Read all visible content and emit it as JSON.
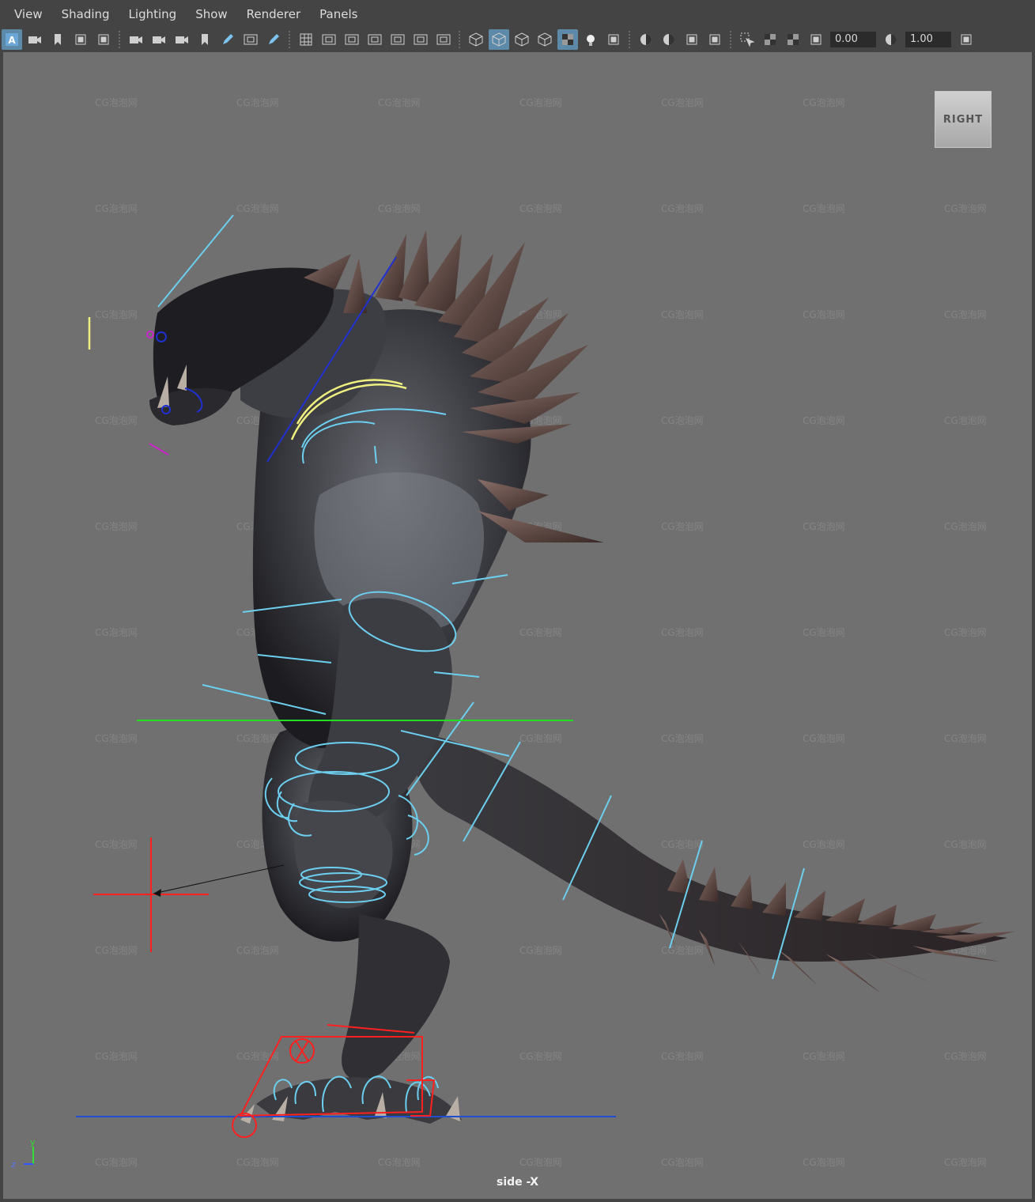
{
  "menu": {
    "items": [
      {
        "id": "view",
        "label": "View"
      },
      {
        "id": "shading",
        "label": "Shading"
      },
      {
        "id": "lighting",
        "label": "Lighting"
      },
      {
        "id": "show",
        "label": "Show"
      },
      {
        "id": "renderer",
        "label": "Renderer"
      },
      {
        "id": "panels",
        "label": "Panels"
      }
    ]
  },
  "toolbar": {
    "exposure_value": "0.00",
    "gamma_value": "1.00",
    "icons": [
      "select-camera-icon",
      "camera-attributes-icon",
      "bookmarks-icon",
      "image-plane-icon",
      "2d-pan-zoom-icon",
      "camera-icon",
      "lock-camera-icon",
      "camera-film-icon",
      "bookmark-icon",
      "grease-pencil-icon",
      "gate-icon",
      "paint-icon",
      "grid-icon",
      "film-gate-icon",
      "resolution-gate-icon",
      "gate-mask-icon",
      "field-chart-icon",
      "safe-action-icon",
      "safe-title-icon",
      "wireframe-icon",
      "smooth-shade-icon",
      "default-material-icon",
      "wireframe-on-shaded-icon",
      "xray-icon",
      "use-lights-icon",
      "shadows-icon",
      "screen-space-ao-icon",
      "motion-blur-icon",
      "anti-aliasing-icon",
      "depth-of-field-icon",
      "isolate-select-icon",
      "xray-joints-icon",
      "xray-active-icon",
      "backface-culling-icon",
      "exposure-icon",
      "gamma-icon",
      "viewport-color-icon"
    ]
  },
  "viewport": {
    "watermark": "CG泡泡网",
    "viewcube_label": "RIGHT",
    "camera_label": "side -X",
    "axis_y": "y",
    "axis_z": "z"
  },
  "colors": {
    "background": "#707070",
    "ui": "#444444",
    "control_curves": "#6ccfef",
    "ik_controls": "#ff2020",
    "ground_line": "#1f4fd0",
    "green_line": "#22dd22",
    "yellow_curve": "#f0f080",
    "magenta": "#cc22cc"
  }
}
